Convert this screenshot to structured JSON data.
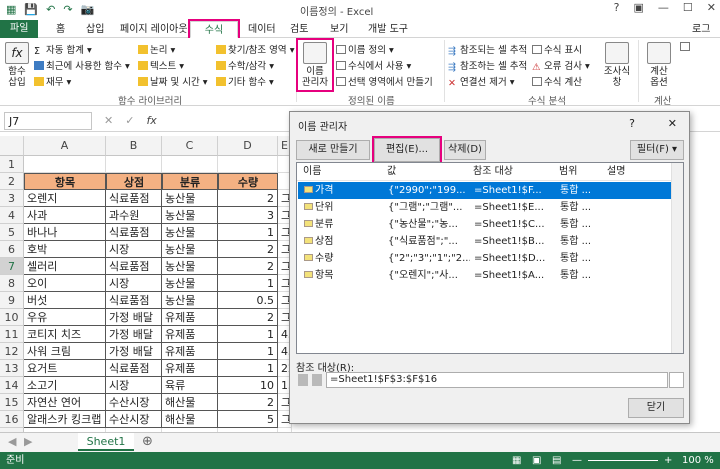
{
  "window": {
    "title": "이름정의 - Excel",
    "user": "로그인"
  },
  "tabs": [
    "파일",
    "홈",
    "삽입",
    "페이지 레이아웃",
    "수식",
    "데이터",
    "검토",
    "보기",
    "개발 도구"
  ],
  "ribbon": {
    "insert_function": "함수\n삽입",
    "autosum": "자동 합계",
    "recent": "최근에 사용한 함수",
    "finance": "재무",
    "logical": "논리",
    "text": "텍스트",
    "datetime": "날짜 및 시간",
    "lookup": "찾기/참조 영역",
    "math": "수학/삼각",
    "more": "기타 함수",
    "group_library": "함수 라이브러리",
    "name_manager": "이름\n관리자",
    "define_name": "이름 정의",
    "use_in_formula": "수식에서 사용",
    "create_from_sel": "선택 영역에서 만들기",
    "group_names": "정의된 이름",
    "trace_prec": "참조되는 셀 추적",
    "trace_dep": "참조하는 셀 추적",
    "remove_arrows": "연결선 제거",
    "show_formulas": "수식 표시",
    "error_check": "오류 검사",
    "eval_formula": "수식 계산",
    "group_audit": "수식 분석",
    "watch": "조사식\n창",
    "calc_opts": "계산\n옵션",
    "group_calc": "계산"
  },
  "formula_bar": {
    "namebox": "J7"
  },
  "columns": [
    "A",
    "B",
    "C",
    "D",
    "E"
  ],
  "rows": [
    "1",
    "2",
    "3",
    "4",
    "5",
    "6",
    "7",
    "8",
    "9",
    "10",
    "11",
    "12",
    "13",
    "14",
    "15",
    "16",
    "17"
  ],
  "table": {
    "headers": [
      "항목",
      "상점",
      "분류",
      "수량"
    ],
    "data": [
      [
        "오렌지",
        "식료품점",
        "농산물",
        "2"
      ],
      [
        "사과",
        "과수원",
        "농산물",
        "3"
      ],
      [
        "바나나",
        "식료품점",
        "농산물",
        "1"
      ],
      [
        "호박",
        "시장",
        "농산물",
        "2"
      ],
      [
        "셀러리",
        "식료품점",
        "농산물",
        "2"
      ],
      [
        "오이",
        "시장",
        "농산물",
        "1"
      ],
      [
        "버섯",
        "식료품점",
        "농산물",
        "0.5"
      ],
      [
        "우유",
        "가정 배달",
        "유제품",
        "2"
      ],
      [
        "코티지 치즈",
        "가정 배달",
        "유제품",
        "1"
      ],
      [
        "사워 크림",
        "가정 배달",
        "유제품",
        "1"
      ],
      [
        "요거트",
        "식료품점",
        "유제품",
        "1"
      ],
      [
        "소고기",
        "시장",
        "육류",
        "10"
      ],
      [
        "자연산 연어",
        "수산시장",
        "해산물",
        "2"
      ],
      [
        "알래스카 킹크랩",
        "수산시장",
        "해산물",
        "5"
      ]
    ],
    "overflow_e": [
      "그",
      "그",
      "그",
      "그",
      "그",
      "그",
      "그",
      "그",
      "45",
      "45",
      "22",
      "15",
      "그",
      "그"
    ]
  },
  "sheet_tab": "Sheet1",
  "status": {
    "left": "준비",
    "zoom": "100 %"
  },
  "dialog": {
    "title": "이름 관리자",
    "help": "?",
    "close": "✕",
    "new_btn": "새로 만들기(N)...",
    "edit_btn": "편집(E)...",
    "delete_btn": "삭제(D)",
    "filter_btn": "필터(F) ▾",
    "cols": [
      "이름",
      "값",
      "참조 대상",
      "범위",
      "설명"
    ],
    "names": [
      [
        "가격",
        "{\"2990\";\"199...",
        "=Sheet1!$F...",
        "통합 ..."
      ],
      [
        "단위",
        "{\"그램\";\"그램\"...",
        "=Sheet1!$E...",
        "통합 ..."
      ],
      [
        "분류",
        "{\"농산물\";\"농...",
        "=Sheet1!$C...",
        "통합 ..."
      ],
      [
        "상점",
        "{\"식료품점\";\"...",
        "=Sheet1!$B...",
        "통합 ..."
      ],
      [
        "수량",
        "{\"2\";\"3\";\"1\";\"2...",
        "=Sheet1!$D...",
        "통합 ..."
      ],
      [
        "항목",
        "{\"오렌지\";\"사...",
        "=Sheet1!$A...",
        "통합 ..."
      ]
    ],
    "refers_label": "참조 대상(R):",
    "refers_value": "=Sheet1!$F$3:$F$16",
    "close_btn": "닫기"
  }
}
